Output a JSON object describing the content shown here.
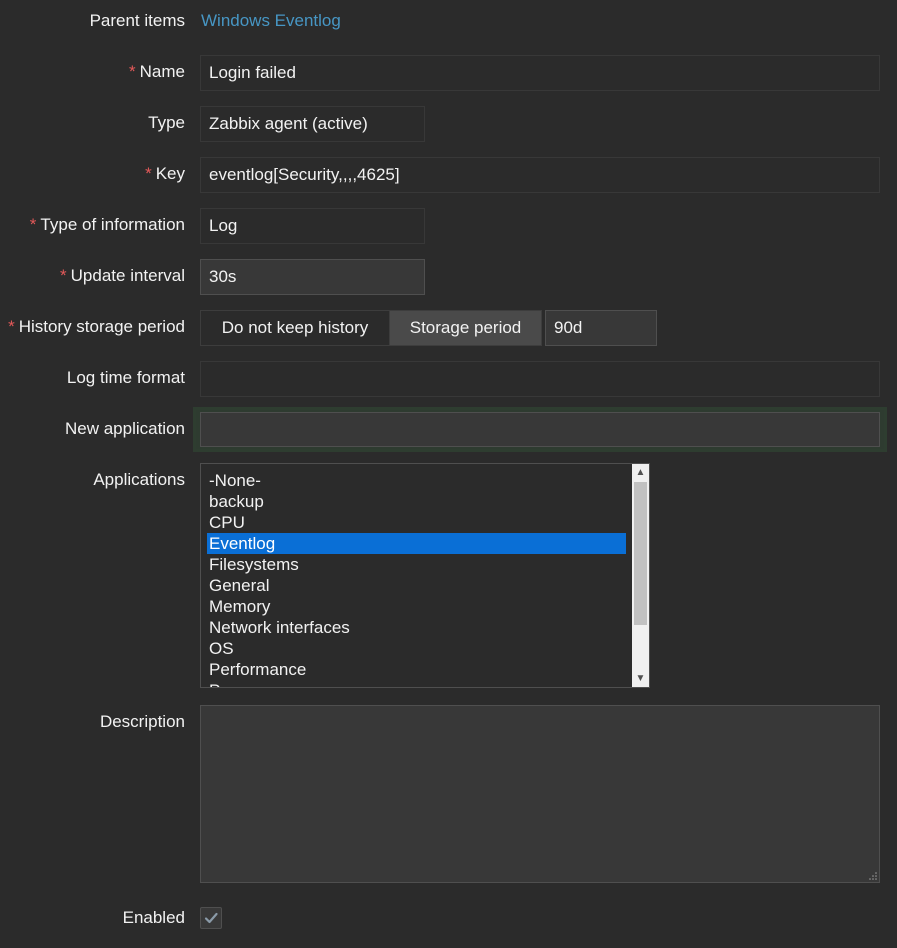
{
  "form": {
    "parent_items": {
      "label": "Parent items",
      "value": "Windows Eventlog"
    },
    "name": {
      "label": "Name",
      "required": "*",
      "value": "Login failed"
    },
    "type": {
      "label": "Type",
      "value": "Zabbix agent (active)"
    },
    "key": {
      "label": "Key",
      "required": "*",
      "value": "eventlog[Security,,,,4625]"
    },
    "type_of_information": {
      "label": "Type of information",
      "required": "*",
      "value": "Log"
    },
    "update_interval": {
      "label": "Update interval",
      "required": "*",
      "value": "30s"
    },
    "history_storage_period": {
      "label": "History storage period",
      "required": "*",
      "options": [
        "Do not keep history",
        "Storage period"
      ],
      "selected": "Storage period",
      "value": "90d"
    },
    "log_time_format": {
      "label": "Log time format",
      "value": ""
    },
    "new_application": {
      "label": "New application",
      "value": ""
    },
    "applications": {
      "label": "Applications",
      "items": [
        "-None-",
        "backup",
        "CPU",
        "Eventlog",
        "Filesystems",
        "General",
        "Memory",
        "Network interfaces",
        "OS",
        "Performance",
        "Processes"
      ],
      "selected": "Eventlog"
    },
    "description": {
      "label": "Description",
      "value": ""
    },
    "enabled": {
      "label": "Enabled",
      "checked": true
    }
  },
  "colors": {
    "background": "#2b2b2b",
    "link": "#4796c4",
    "required": "#e45959",
    "selection": "#0a6fd6"
  }
}
